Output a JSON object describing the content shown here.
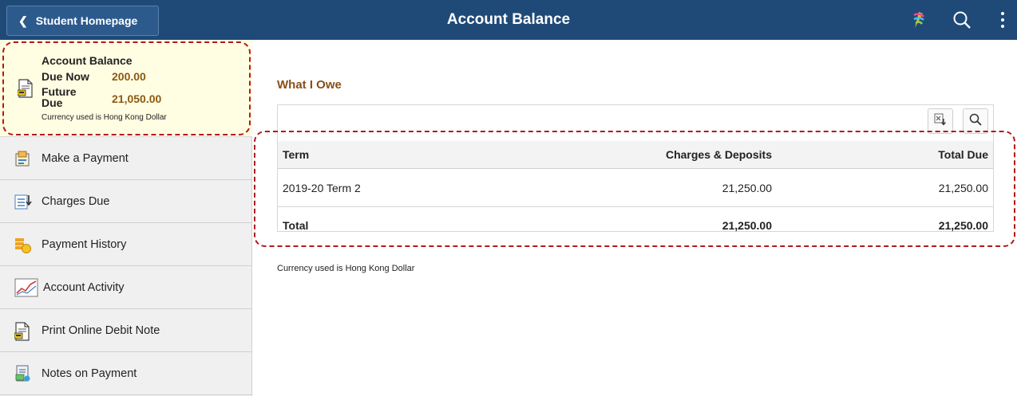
{
  "header": {
    "back_label": "Student Homepage",
    "title": "Account Balance",
    "icons": [
      "back-chevron-icon",
      "navbar-compass-icon",
      "search-icon",
      "more-actions-icon"
    ],
    "bar_color": "#1f4a78"
  },
  "sidebar": {
    "balance_tile": {
      "title": "Account Balance",
      "due_now_label": "Due Now",
      "due_now_value": "200.00",
      "future_due_label_1": "Future",
      "future_due_label_2": "Due",
      "future_due_value": "21,050.00",
      "currency_note": "Currency used is Hong Kong Dollar"
    },
    "items": [
      {
        "label": "Make a Payment",
        "icon": "payment-icon"
      },
      {
        "label": "Charges Due",
        "icon": "charges-icon"
      },
      {
        "label": "Payment History",
        "icon": "coins-icon"
      },
      {
        "label": "Account Activity",
        "icon": "chart-line-icon"
      },
      {
        "label": "Print Online Debit Note",
        "icon": "document-icon"
      },
      {
        "label": "Notes on Payment",
        "icon": "notes-icon"
      }
    ]
  },
  "main": {
    "section_title": "What I Owe",
    "grid": {
      "columns": [
        "Term",
        "Charges & Deposits",
        "Total Due"
      ],
      "rows": [
        {
          "term": "2019-20 Term 2",
          "charges": "21,250.00",
          "total_due": "21,250.00"
        }
      ],
      "total": {
        "label": "Total",
        "charges": "21,250.00",
        "total_due": "21,250.00"
      }
    },
    "currency_note": "Currency used is Hong Kong Dollar"
  },
  "colors": {
    "accent_brown": "#8a4f16",
    "value_brown": "#8a5a14",
    "annotation_red": "#b11a1a",
    "tile_yellow": "#fffde2"
  }
}
